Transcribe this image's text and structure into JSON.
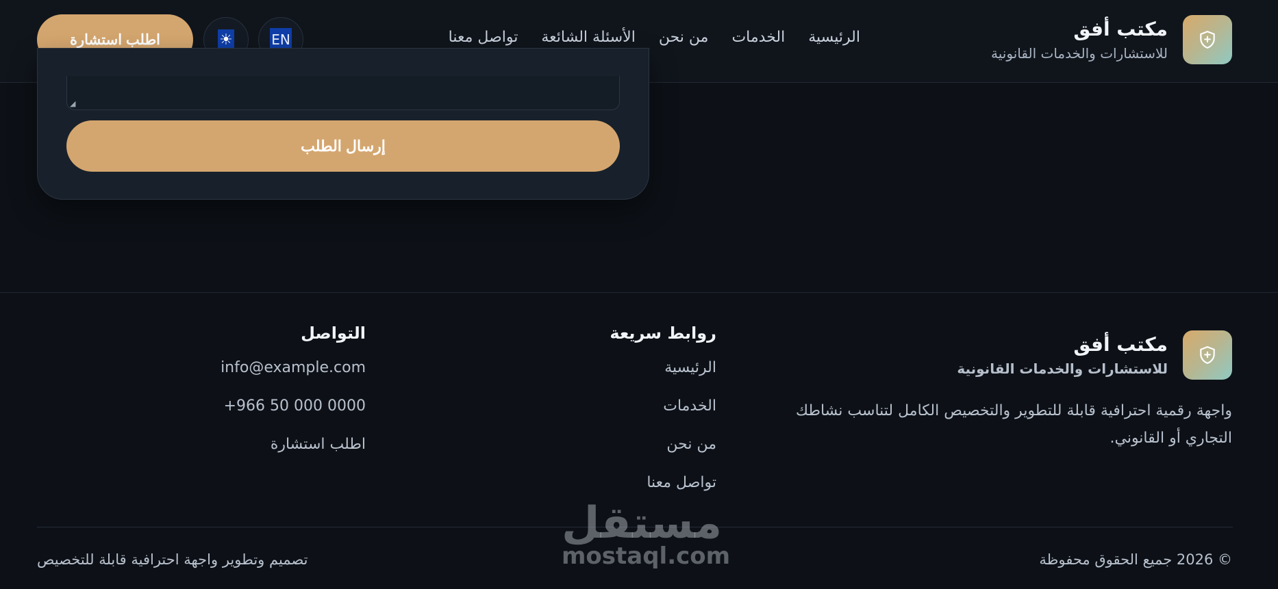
{
  "header": {
    "brand_name": "مكتب أفق",
    "brand_sub": "للاستشارات والخدمات القانونية",
    "logo_icon": "shield-plus-icon",
    "nav": [
      "الرئيسية",
      "الخدمات",
      "من نحن",
      "الأسئلة الشائعة",
      "تواصل معنا"
    ],
    "lang_label": "EN",
    "theme_icon": "☀",
    "cta_label": "اطلب استشارة"
  },
  "form": {
    "submit_label": "إرسال الطلب"
  },
  "footer": {
    "brand_name": "مكتب أفق",
    "brand_sub": "للاستشارات والخدمات القانونية",
    "description": "واجهة رقمية احترافية قابلة للتطوير والتخصيص الكامل لتناسب نشاطك التجاري أو القانوني.",
    "quick_title": "روابط سريعة",
    "quick_links": [
      "الرئيسية",
      "الخدمات",
      "من نحن",
      "تواصل معنا"
    ],
    "contact_title": "التواصل",
    "contact_items": [
      "info@example.com",
      "+966 50 000 0000",
      "اطلب استشارة"
    ],
    "copyright": "© 2026 جميع الحقوق محفوظة",
    "credit": "تصميم وتطوير واجهة احترافية قابلة للتخصيص"
  },
  "watermark": {
    "arabic": "مستقل",
    "latin": "mostaql.com"
  },
  "colors": {
    "background": "#0d1117",
    "accent": "#d4a66f",
    "lang_highlight": "#0f3ea8"
  }
}
